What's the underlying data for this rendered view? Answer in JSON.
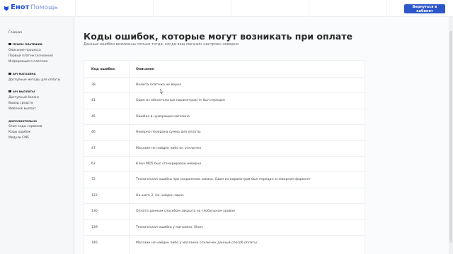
{
  "header": {
    "logo_brand": "Енот",
    "logo_help": "Помощь",
    "back_button": "Вернуться в кабинет"
  },
  "sidebar": {
    "home": "Главная",
    "sections": [
      {
        "title": "ПРИЕМ ПЛАТЕЖЕЙ",
        "items": [
          "Описание процесса",
          "Первый платеж (основное)",
          "Информация о платеже"
        ]
      },
      {
        "title": "API МАГАЗИНА",
        "items": [
          "Доступные методы для оплаты"
        ]
      },
      {
        "title": "API ВЫПЛАТЫ",
        "items": [
          "Доступный баланс",
          "Вывод средств",
          "Webhook выплат"
        ]
      },
      {
        "title": "ДОПОЛНИТЕЛЬНО",
        "items": [
          "Short коды сервисов",
          "Коды ошибок",
          "Модули CMS"
        ]
      }
    ]
  },
  "main": {
    "title": "Коды ошибок, которые могут возникать при оплате",
    "subtitle": "Данные ошибки возможны только тогда, когда ваш магазин настроен неверно",
    "table": {
      "headers": {
        "code": "Код ошибки",
        "description": "Описание"
      },
      "rows": [
        {
          "code": "39",
          "description": "Валюта платежа не верна"
        },
        {
          "code": "41",
          "description": "Один из обязательных параметров не был передан"
        },
        {
          "code": "45",
          "description": "Ошибка в нумерации магазина"
        },
        {
          "code": "46",
          "description": "Неверно передана сумма для оплаты"
        },
        {
          "code": "47",
          "description": "Магазин не найден либо он отключен"
        },
        {
          "code": "62",
          "description": "Ключ MD5 был сгенерирован неверно"
        },
        {
          "code": "72",
          "description": "Техническая ошибка при сохранении заказа. Один из параметров был передан в неверном формате"
        },
        {
          "code": "122",
          "description": "На шаге 2, Не найден заказ"
        },
        {
          "code": "130",
          "description": "Оплата данным способом закрыта на глобальном уровне"
        },
        {
          "code": "139",
          "description": "Техническая ошибка у магазина. Short"
        },
        {
          "code": "146",
          "description": "Магазин не найден либо у магазина отключен данный способ оплаты"
        }
      ]
    }
  },
  "colors": {
    "accent": "#2d56c9",
    "brand": "#1f4fd8"
  }
}
